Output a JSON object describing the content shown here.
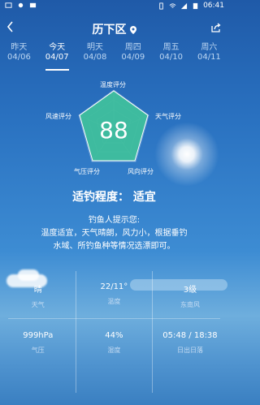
{
  "status": {
    "time": "06:41"
  },
  "header": {
    "city": "历下区"
  },
  "days": [
    {
      "name": "昨天",
      "date": "04/06"
    },
    {
      "name": "今天",
      "date": "04/07"
    },
    {
      "name": "明天",
      "date": "04/08"
    },
    {
      "name": "周四",
      "date": "04/09"
    },
    {
      "name": "周五",
      "date": "04/10"
    },
    {
      "name": "周六",
      "date": "04/11"
    }
  ],
  "radar": {
    "labels": {
      "temp": "温度评分",
      "weather": "天气评分",
      "wind_dir": "风向评分",
      "pressure": "气压评分",
      "wind_speed": "风速评分"
    },
    "score": "88",
    "fill_color": "#3fbf9d"
  },
  "suitability": "适钓程度： 适宜",
  "tips": {
    "title": "钓鱼人提示您:",
    "line1": "温度适宜，天气晴朗，风力小，根据垂钓",
    "line2": "水域、所钓鱼种等情况选漂即可。"
  },
  "stats_row1": [
    {
      "value": "晴",
      "label": "天气"
    },
    {
      "value": "22/11°",
      "label": "温度"
    },
    {
      "value": "3级",
      "label": "东南风"
    }
  ],
  "stats_row2": [
    {
      "value": "999hPa",
      "label": "气压"
    },
    {
      "value": "44%",
      "label": "湿度"
    },
    {
      "value": "05:48 / 18:38",
      "label": "日出日落"
    }
  ]
}
